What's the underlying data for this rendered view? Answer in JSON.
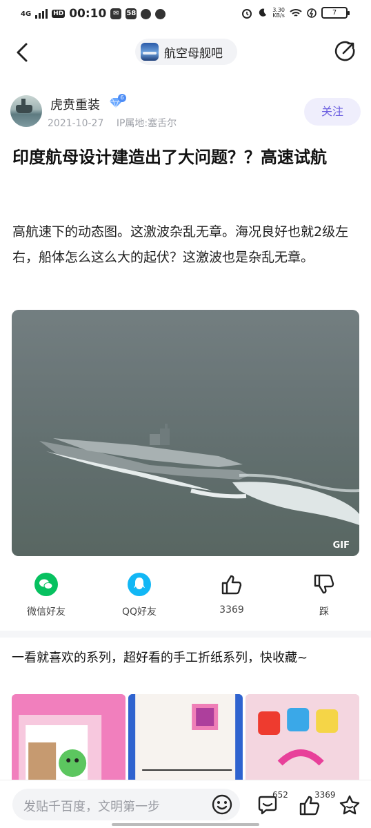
{
  "status_bar": {
    "network": "4G",
    "hd": "HD",
    "time": "00:10",
    "notif_count": "58",
    "net_speed_value": "3.30",
    "net_speed_unit": "KB/s",
    "battery": "7"
  },
  "header": {
    "forum_name": "航空母舰吧"
  },
  "author": {
    "name": "虎贲重装",
    "level": "6",
    "date": "2021-10-27",
    "ip_location": "IP属地:塞舌尔",
    "follow_label": "关注"
  },
  "post": {
    "title": "印度航母设计建造出了大问题？？高速试航",
    "body": "高航速下的动态图。这激波杂乱无章。海况良好也就2级左右，船体怎么这么大的起伏？这激波也是杂乱无章。",
    "media_badge": "GIF"
  },
  "actions": {
    "wechat_label": "微信好友",
    "qq_label": "QQ好友",
    "like_count": "3369",
    "dislike_label": "踩"
  },
  "recommend": {
    "title": "一看就喜欢的系列，超好看的手工折纸系列，快收藏~"
  },
  "bottom_bar": {
    "reply_placeholder": "发贴千百度，文明第一步",
    "comment_count": "652",
    "like_count": "3369"
  },
  "colors": {
    "accent": "#6c5fe0",
    "follow_bg": "#efeefc",
    "wechat_green": "#07c160",
    "qq_blue": "#12b7f5"
  }
}
